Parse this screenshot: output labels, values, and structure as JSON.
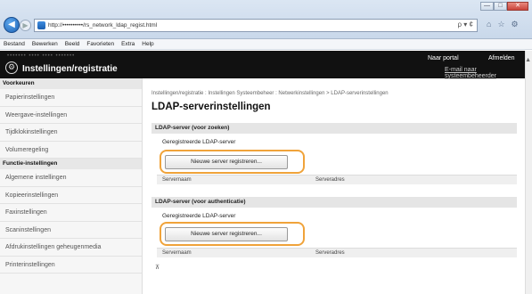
{
  "window": {
    "minimize": "—",
    "maximize": "□",
    "close": "✕"
  },
  "browser": {
    "url": "http://••••••••••/rs_network_ldap_regist.html",
    "url_hint": "ρ ▾ ¢",
    "menu": [
      "Bestand",
      "Bewerken",
      "Beeld",
      "Favorieten",
      "Extra",
      "Help"
    ]
  },
  "header": {
    "device_info": "••••••• ••••  •••• •••••••",
    "title": "Instellingen/registratie",
    "portal": "Naar portal",
    "logout": "Afmelden",
    "email_admin": "E-mail naar systeembeheerder"
  },
  "sidebar": {
    "group1": "Voorkeuren",
    "items1": [
      "Papierinstellingen",
      "Weergave-instellingen",
      "Tijdklokinstellingen",
      "Volumeregeling"
    ],
    "group2": "Functie-instellingen",
    "items2": [
      "Algemene instellingen",
      "Kopieerinstellingen",
      "Faxinstellingen",
      "Scaninstellingen",
      "Afdrukinstellingen geheugenmedia",
      "Printerinstellingen"
    ]
  },
  "main": {
    "breadcrumb": "Instellingen/registratie : Instellingen Systeembeheer : Netwerkinstellingen > LDAP-serverinstellingen",
    "heading": "LDAP-serverinstellingen",
    "search_section": {
      "title": "LDAP-server (voor zoeken)",
      "sub": "Geregistreerde LDAP-server",
      "button": "Nieuwe server registreren...",
      "col_name": "Servernaam",
      "col_addr": "Serveradres"
    },
    "auth_section": {
      "title": "LDAP-server (voor authenticatie)",
      "sub": "Geregistreerde LDAP-server",
      "button": "Nieuwe server registreren...",
      "col_name": "Servernaam",
      "col_addr": "Serveradres"
    },
    "to_top": "⊼"
  },
  "colors": {
    "highlight": "#f0a33a",
    "header_bg": "#111111"
  }
}
